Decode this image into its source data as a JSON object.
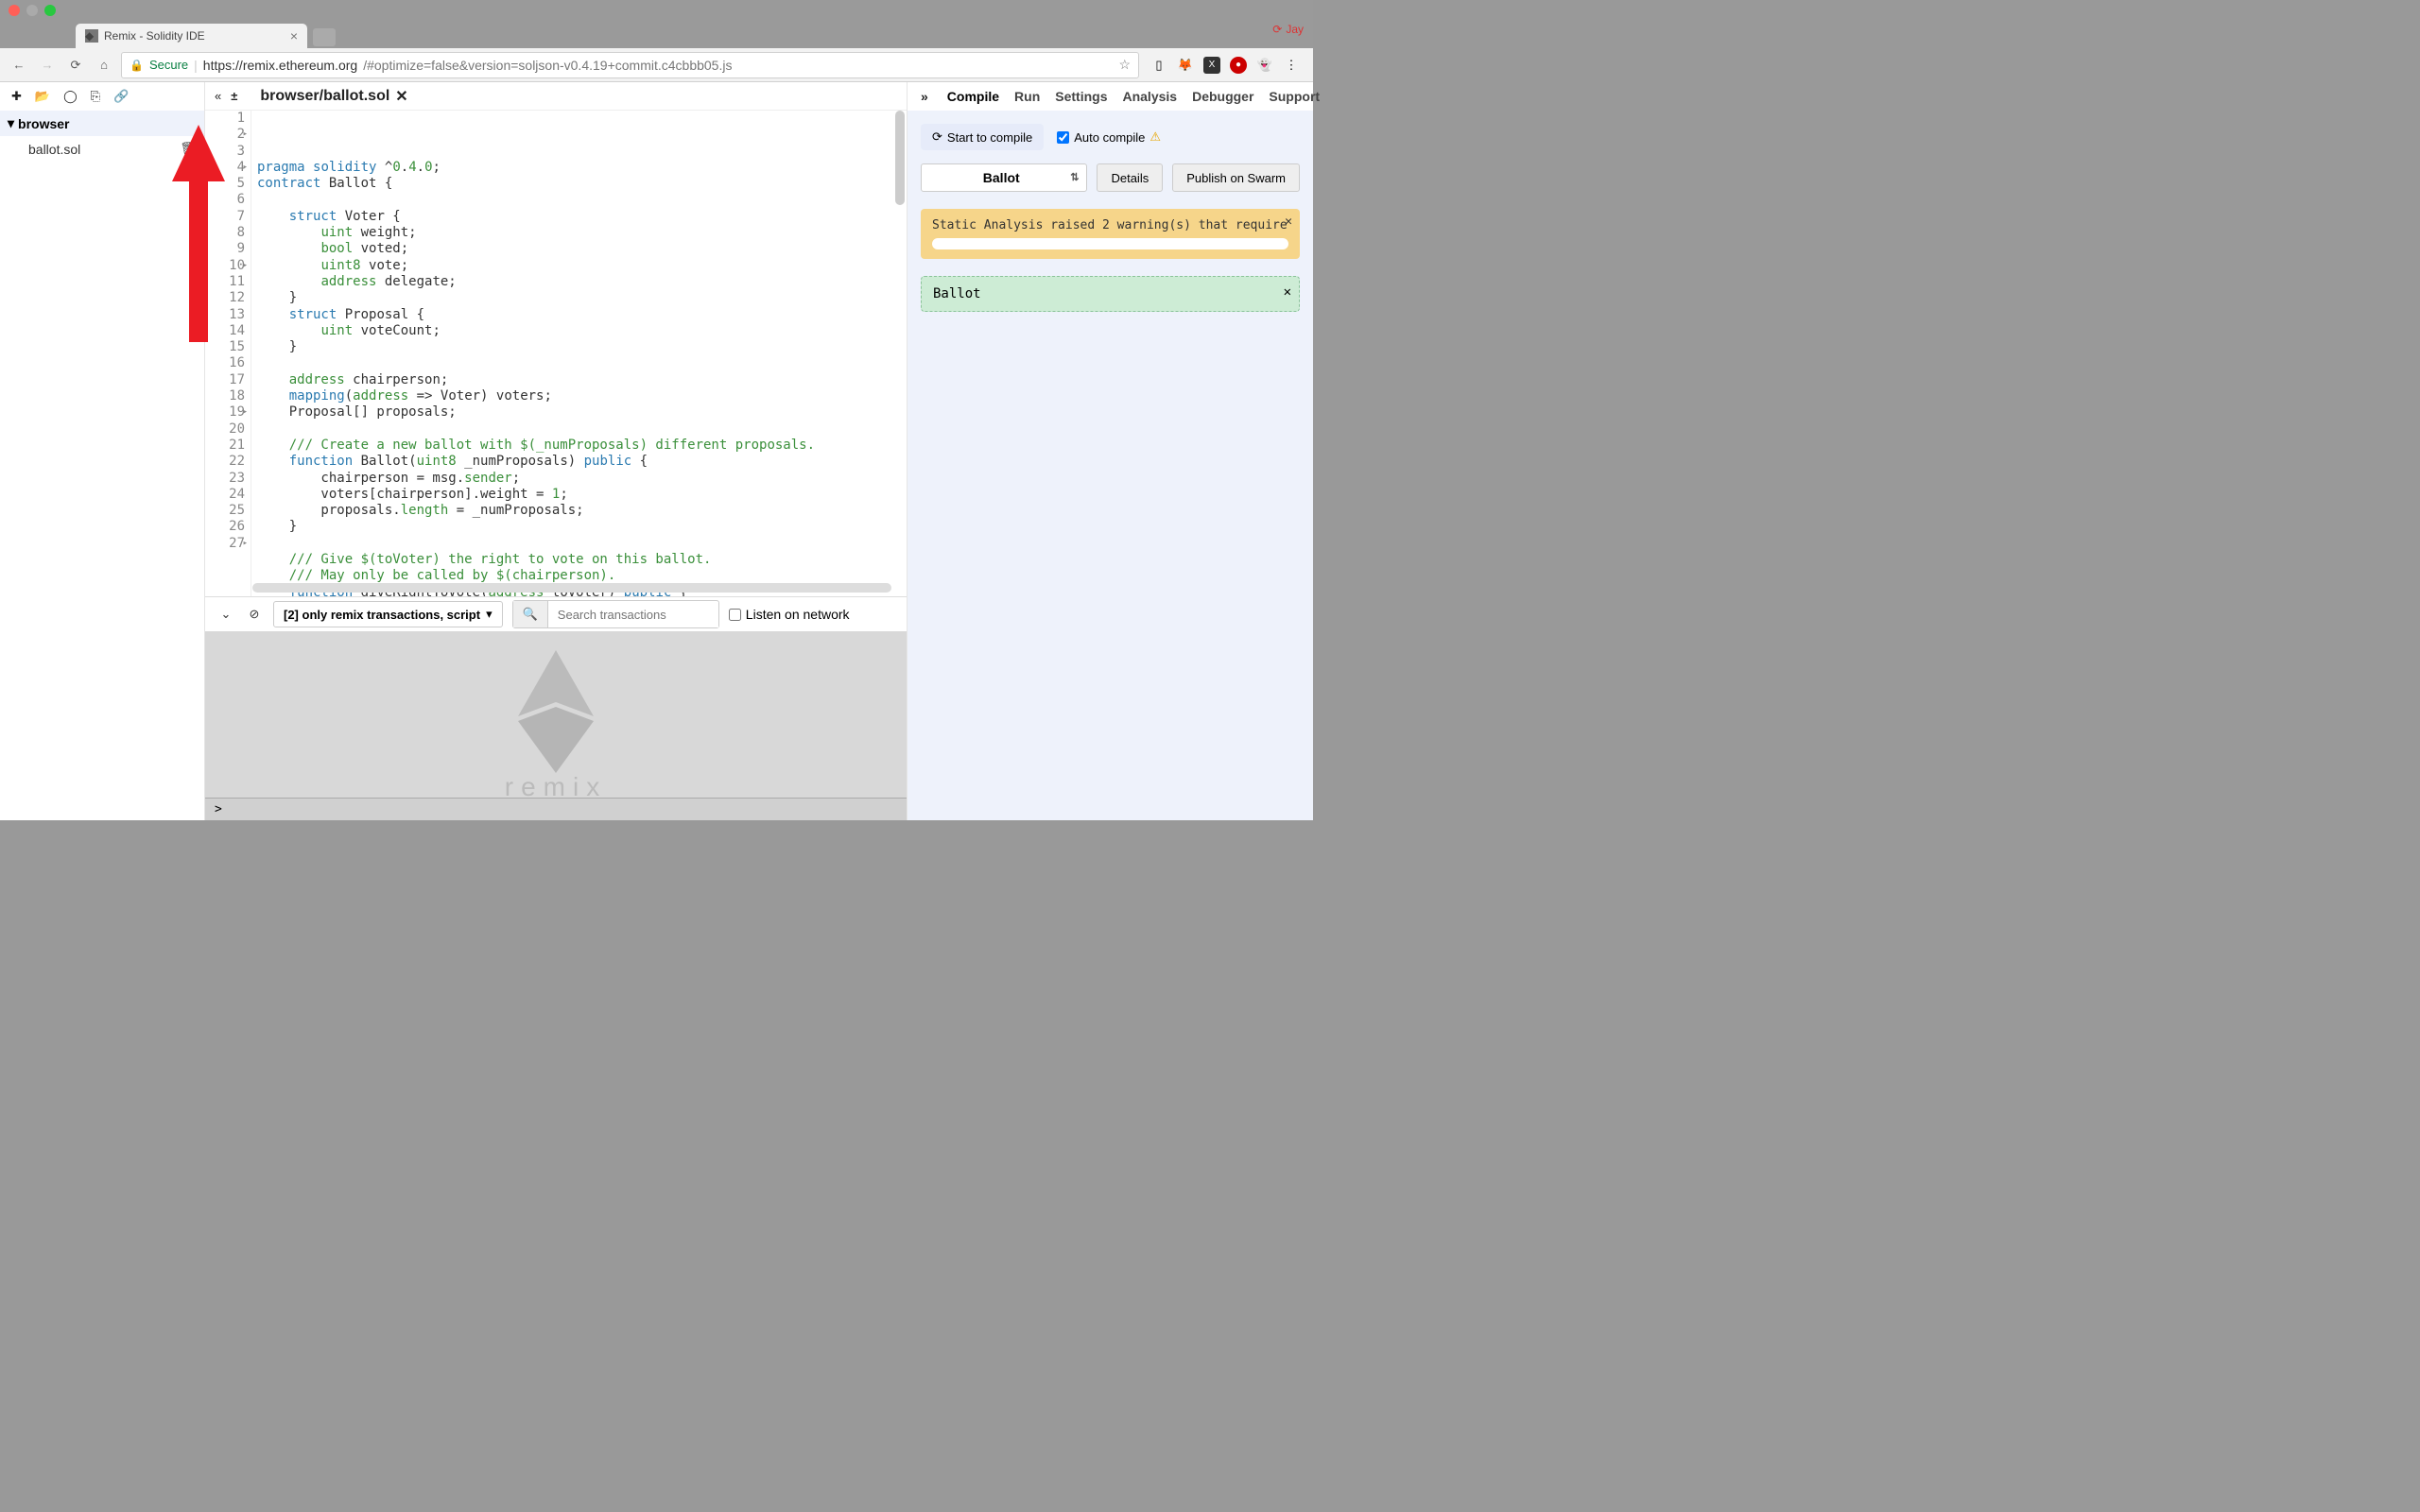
{
  "window": {
    "tab_title": "Remix - Solidity IDE",
    "profile": "Jay"
  },
  "omnibox": {
    "secure": "Secure",
    "host": "https://remix.ethereum.org",
    "path": "/#optimize=false&version=soljson-v0.4.19+commit.c4cbbb05.js"
  },
  "sidebar": {
    "folder": "browser",
    "files": [
      "ballot.sol"
    ]
  },
  "editor": {
    "tab": "browser/ballot.sol",
    "lines": [
      "pragma solidity ^0.4.0;",
      "contract Ballot {",
      "",
      "    struct Voter {",
      "        uint weight;",
      "        bool voted;",
      "        uint8 vote;",
      "        address delegate;",
      "    }",
      "    struct Proposal {",
      "        uint voteCount;",
      "    }",
      "",
      "    address chairperson;",
      "    mapping(address => Voter) voters;",
      "    Proposal[] proposals;",
      "",
      "    /// Create a new ballot with $(_numProposals) different proposals.",
      "    function Ballot(uint8 _numProposals) public {",
      "        chairperson = msg.sender;",
      "        voters[chairperson].weight = 1;",
      "        proposals.length = _numProposals;",
      "    }",
      "",
      "    /// Give $(toVoter) the right to vote on this ballot.",
      "    /// May only be called by $(chairperson).",
      "    function giveRightToVote(address toVoter) public {"
    ]
  },
  "console": {
    "filter": "[2] only remix transactions, script",
    "search_placeholder": "Search transactions",
    "listen": "Listen on network",
    "prompt": ">"
  },
  "right": {
    "tabs": [
      "Compile",
      "Run",
      "Settings",
      "Analysis",
      "Debugger",
      "Support"
    ],
    "active_tab": "Compile",
    "start_compile": "Start to compile",
    "auto_compile": "Auto compile",
    "selected_contract": "Ballot",
    "details": "Details",
    "swarm": "Publish on Swarm",
    "warning": "Static Analysis raised 2 warning(s) that require",
    "contract_result": "Ballot"
  }
}
